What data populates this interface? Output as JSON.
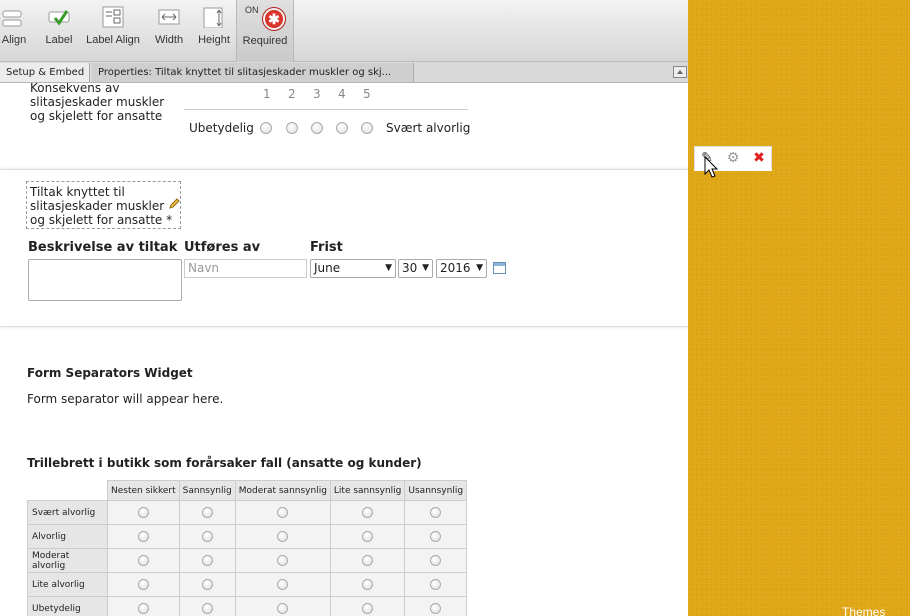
{
  "toolbar": {
    "tools": [
      {
        "label": "Align",
        "icon": "align-icon"
      },
      {
        "label": "Label",
        "icon": "label-icon"
      },
      {
        "label": "Label Align",
        "icon": "label-align-icon"
      },
      {
        "label": "Width",
        "icon": "width-icon"
      },
      {
        "label": "Height",
        "icon": "height-icon"
      }
    ],
    "required": {
      "label": "Required",
      "state": "ON",
      "icon": "required-asterisk-icon"
    }
  },
  "tabs": {
    "setup": "Setup & Embed",
    "properties": "Properties: Tiltak knyttet til slitasjeskader muskler og skj..."
  },
  "scale_question": {
    "label": "Konsekvens av slitasjeskader muskler og skjelett for ansatte",
    "numbers": [
      "1",
      "2",
      "3",
      "4",
      "5"
    ],
    "low": "Ubetydelig",
    "high": "Svært alvorlig"
  },
  "active_field": {
    "label": "Tiltak knyttet til slitasjeskader muskler og skjelett for ansatte *",
    "col1": "Beskrivelse av tiltak",
    "col2": "Utføres av",
    "col3": "Frist",
    "name_placeholder": "Navn",
    "month": "June",
    "day": "30",
    "year": "2016"
  },
  "separator_widget": {
    "title": "Form Separators Widget",
    "text": "Form separator will appear here."
  },
  "matrix": {
    "title": "Trillebrett i butikk som forårsaker fall (ansatte og kunder)",
    "columns": [
      "Nesten sikkert",
      "Sannsynlig",
      "Moderat sannsynlig",
      "Lite sannsynlig",
      "Usannsynlig"
    ],
    "rows": [
      "Svært alvorlig",
      "Alvorlig",
      "Moderat alvorlig",
      "Lite alvorlig",
      "Ubetydelig"
    ]
  },
  "theme": {
    "label": "Themes",
    "color": "#e0a615"
  }
}
